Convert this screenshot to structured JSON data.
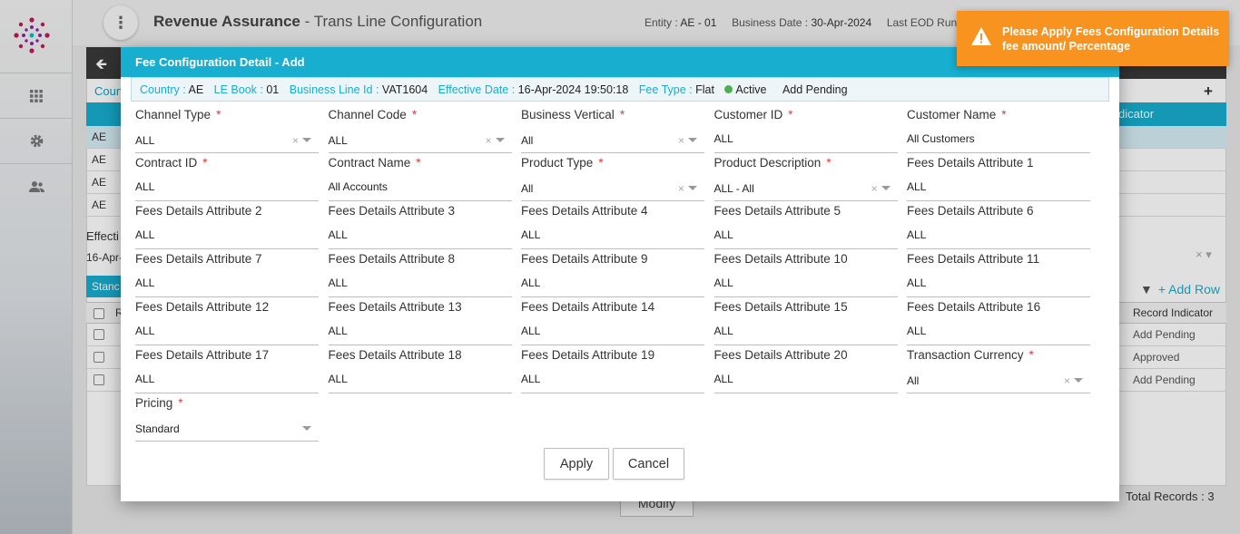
{
  "app": {
    "title": "Revenue Assurance",
    "subtitle": " - Trans Line Configuration"
  },
  "header_info": {
    "entity_label": "Entity : ",
    "entity_value": "AE - 01",
    "business_date_label": "Business Date : ",
    "business_date_value": "30-Apr-2024",
    "last_eod_label": "Last EOD Run Date"
  },
  "toast": {
    "message": "Please Apply Fees Configuration Details fee amount/ Percentage",
    "color": "#f7931e"
  },
  "background": {
    "country_tab": "Coun",
    "header_indicator": "dicator",
    "rows": [
      "AE",
      "AE",
      "AE",
      "AE"
    ],
    "effective_label": "Effecti",
    "effective_value": "16-Apr-",
    "standard_tab": "Stanc",
    "add_row": "Add Row",
    "table_header": "Record Indicator",
    "first_col_header": "R",
    "record_rows": [
      "Add Pending",
      "Approved",
      "Add Pending"
    ],
    "modify_button": "Modify",
    "total_records_label": "Total Records",
    "total_records_sep": " : ",
    "total_records_value": "3"
  },
  "modal": {
    "title": "Fee Configuration Detail - Add",
    "context": {
      "country_label": "Country : ",
      "country_value": "AE",
      "le_book_label": "LE Book : ",
      "le_book_value": "01",
      "business_line_label": "Business Line Id : ",
      "business_line_value": "VAT1604",
      "effective_date_label": "Effective Date : ",
      "effective_date_value": "16-Apr-2024 19:50:18",
      "fee_type_label": "Fee Type : ",
      "fee_type_value": "Flat",
      "status": "Active",
      "record_status": "Add Pending"
    },
    "fields": [
      {
        "label": "Channel Type",
        "required": true,
        "value": "ALL",
        "select": true,
        "clearable": true
      },
      {
        "label": "Channel Code",
        "required": true,
        "value": "ALL",
        "select": true,
        "clearable": true
      },
      {
        "label": "Business Vertical",
        "required": true,
        "value": "All",
        "select": true,
        "clearable": true
      },
      {
        "label": "Customer ID",
        "required": true,
        "value": "ALL"
      },
      {
        "label": "Customer Name",
        "required": true,
        "value": "All Customers"
      },
      {
        "label": "Contract ID",
        "required": true,
        "value": "ALL"
      },
      {
        "label": "Contract Name",
        "required": true,
        "value": "All Accounts"
      },
      {
        "label": "Product Type",
        "required": true,
        "value": "All",
        "select": true,
        "clearable": true
      },
      {
        "label": "Product Description",
        "required": true,
        "value": "ALL - All",
        "select": true,
        "clearable": true
      },
      {
        "label": "Fees Details Attribute 1",
        "value": "ALL"
      },
      {
        "label": "Fees Details Attribute 2",
        "value": "ALL"
      },
      {
        "label": "Fees Details Attribute 3",
        "value": "ALL"
      },
      {
        "label": "Fees Details Attribute 4",
        "value": "ALL"
      },
      {
        "label": "Fees Details Attribute 5",
        "value": "ALL"
      },
      {
        "label": "Fees Details Attribute 6",
        "value": "ALL"
      },
      {
        "label": "Fees Details Attribute 7",
        "value": "ALL"
      },
      {
        "label": "Fees Details Attribute 8",
        "value": "ALL"
      },
      {
        "label": "Fees Details Attribute 9",
        "value": "ALL"
      },
      {
        "label": "Fees Details Attribute 10",
        "value": "ALL"
      },
      {
        "label": "Fees Details Attribute 11",
        "value": "ALL"
      },
      {
        "label": "Fees Details Attribute 12",
        "value": "ALL"
      },
      {
        "label": "Fees Details Attribute 13",
        "value": "ALL"
      },
      {
        "label": "Fees Details Attribute 14",
        "value": "ALL"
      },
      {
        "label": "Fees Details Attribute 15",
        "value": "ALL"
      },
      {
        "label": "Fees Details Attribute 16",
        "value": "ALL"
      },
      {
        "label": "Fees Details Attribute 17",
        "value": "ALL"
      },
      {
        "label": "Fees Details Attribute 18",
        "value": "ALL"
      },
      {
        "label": "Fees Details Attribute 19",
        "value": "ALL"
      },
      {
        "label": "Fees Details Attribute 20",
        "value": "ALL"
      },
      {
        "label": "Transaction Currency",
        "required": true,
        "value": "All",
        "select": true,
        "clearable": true
      },
      {
        "label": "Pricing",
        "required": true,
        "value": "Standard",
        "select": true,
        "clearable": false
      }
    ],
    "apply_label": "Apply",
    "cancel_label": "Cancel"
  },
  "colors": {
    "accent": "#17aed0",
    "required": "#e53935",
    "active_dot": "#4caf50"
  }
}
